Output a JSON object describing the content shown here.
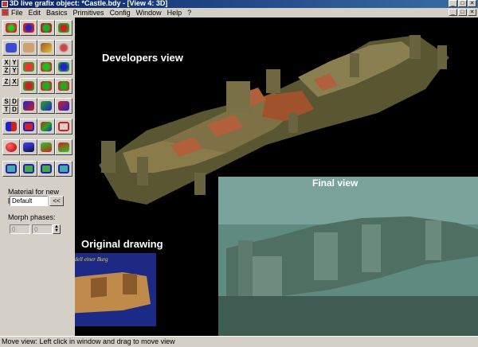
{
  "window": {
    "title": "3D live grafix object: *Castle.bdy - [View 4: 3D]",
    "controls": {
      "minimize": "_",
      "maximize": "□",
      "close": "✕"
    }
  },
  "menubar": {
    "items": [
      "File",
      "Edit",
      "Basics",
      "Primitives",
      "Config",
      "Window",
      "Help",
      "?"
    ]
  },
  "toolbar": {
    "small_letters": [
      "X",
      "Y",
      "Z",
      "Y",
      "Z",
      "X",
      "S",
      "D",
      "T",
      "D"
    ]
  },
  "material": {
    "label": "Material for new polys:",
    "value": "Default",
    "button": "<<"
  },
  "morph": {
    "label": "Morph phases:",
    "value1": "0",
    "value2": "0"
  },
  "viewport": {
    "captions": {
      "developers": "Developers view",
      "final": "Final view",
      "original": "Original drawing"
    },
    "drawing_title": "Modell einer Burg"
  },
  "status": {
    "text": "Move view: Left click in window and drag to move view"
  },
  "colors": {
    "titlebar": "#0a246a",
    "viewport_bg": "#000000",
    "final_view": "#5f8a80",
    "drawing_bg": "#1c2a86"
  }
}
